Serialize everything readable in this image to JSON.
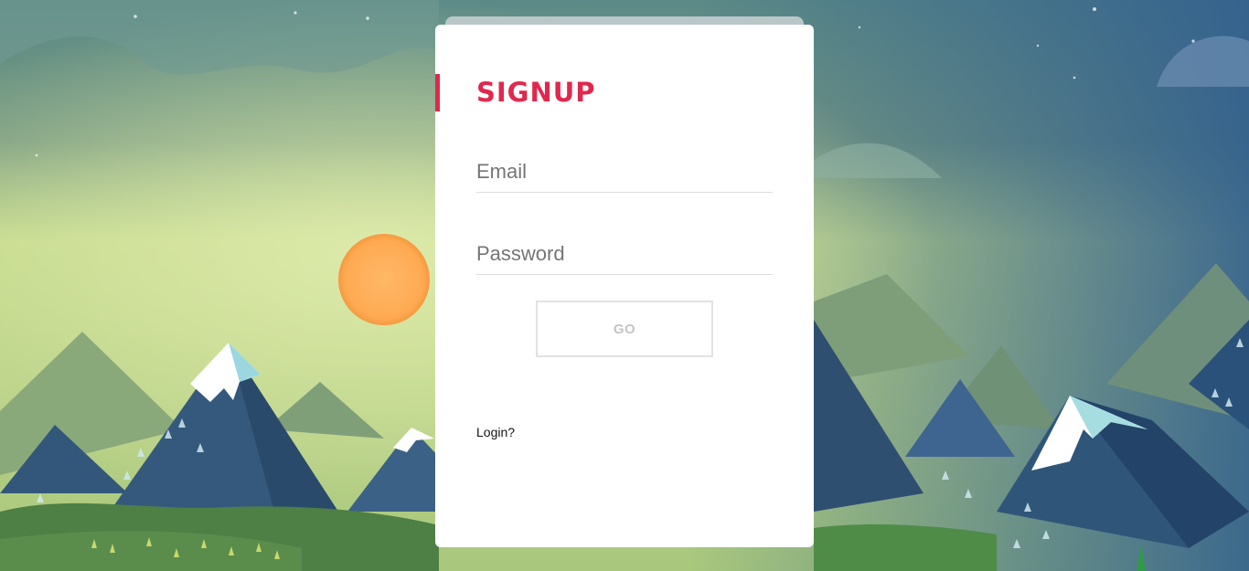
{
  "form": {
    "title": "SIGNUP",
    "email_placeholder": "Email",
    "password_placeholder": "Password",
    "submit_label": "GO",
    "login_link": "Login?"
  },
  "colors": {
    "accent": "#e0284e",
    "card": "#ffffff",
    "sky_top": "#305e8e",
    "sky_glow": "#c6da8a",
    "sun": "#ffad55",
    "grass": "#4e8c48"
  },
  "background": {
    "scene": "mountain-landscape-illustration"
  }
}
